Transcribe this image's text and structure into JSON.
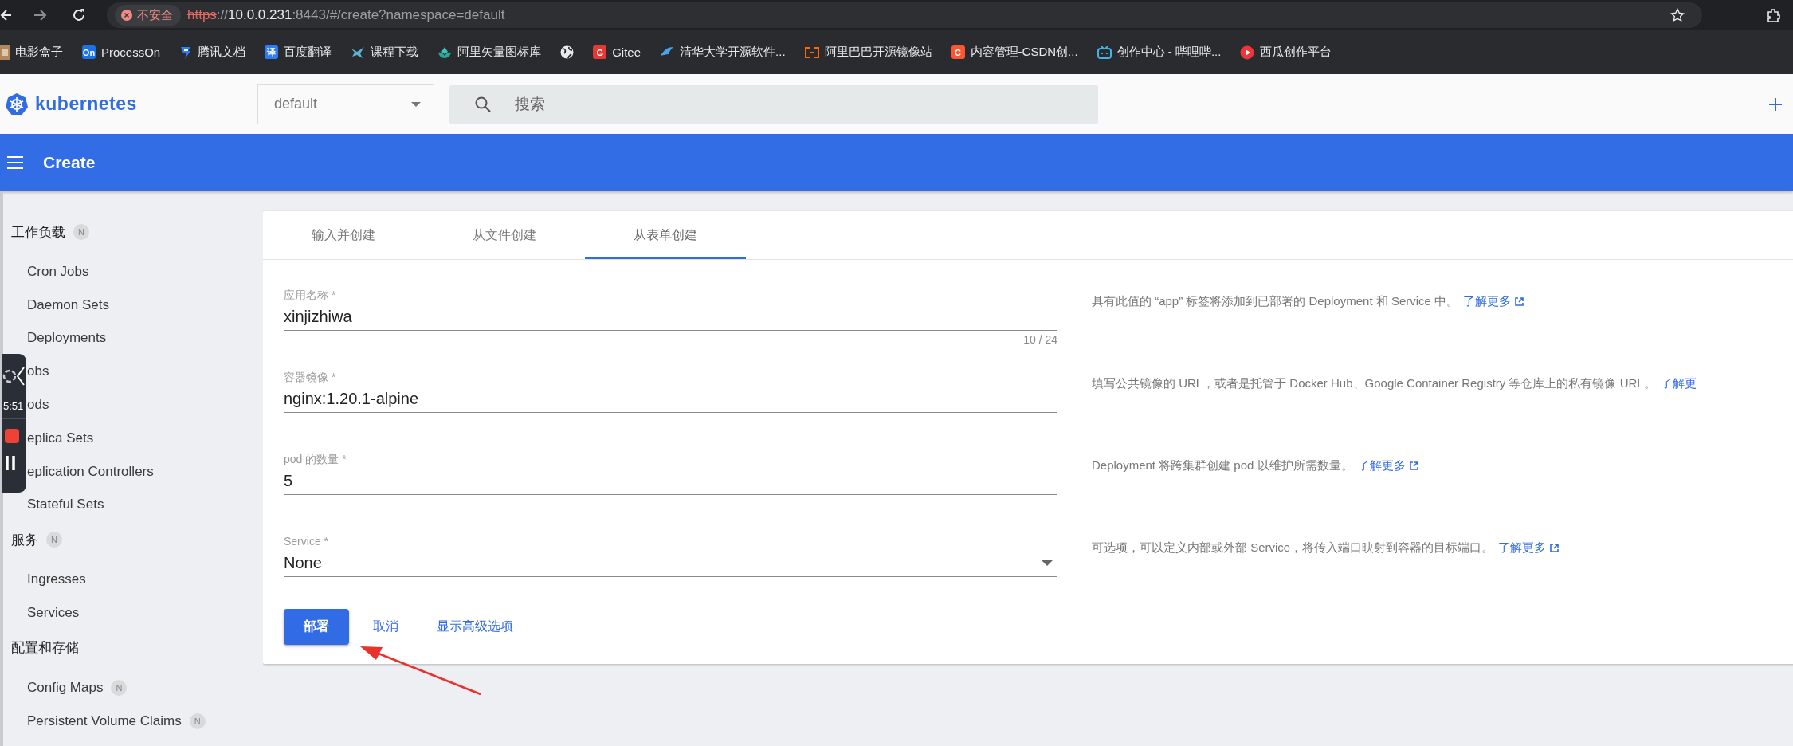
{
  "browser": {
    "security_chip": "不安全",
    "url": [
      {
        "kind": "scheme",
        "text": "https"
      },
      {
        "kind": "separator",
        "text": "://"
      },
      {
        "kind": "host",
        "text": "10.0.0.231"
      },
      {
        "kind": "path",
        "text": ":8443/#/create?namespace=default"
      }
    ],
    "bookmarks": [
      {
        "label": "电影盒子",
        "kind": "image"
      },
      {
        "label": "ProcessOn",
        "kind": "badge",
        "icon_text": "On",
        "color": "#1a73e8"
      },
      {
        "label": "腾讯文档",
        "kind": "doc"
      },
      {
        "label": "百度翻译",
        "kind": "badge",
        "icon_text": "译",
        "color": "#2f7cf6"
      },
      {
        "label": "课程下载",
        "kind": "bird"
      },
      {
        "label": "阿里矢量图标库",
        "kind": "lotus"
      },
      {
        "kind": "globe"
      },
      {
        "label": "Gitee",
        "kind": "badge",
        "icon_text": "G",
        "color": "#e53935"
      },
      {
        "label": "清华大学开源软件...",
        "kind": "wing"
      },
      {
        "label": "阿里巴巴开源镜像站",
        "kind": "bracket"
      },
      {
        "label": "内容管理-CSDN创...",
        "kind": "badge",
        "icon_text": "C",
        "color": "#fc5531"
      },
      {
        "label": "创作中心 - 哔哩哔...",
        "kind": "tv"
      },
      {
        "label": "西瓜创作平台",
        "kind": "play"
      }
    ]
  },
  "header": {
    "brand": "kubernetes",
    "namespace": "default",
    "search_placeholder": "搜索"
  },
  "title_bar": {
    "title": "Create"
  },
  "sidebar": {
    "groups": [
      {
        "title": "工作负载",
        "badge": "N",
        "items": [
          {
            "label": "Cron Jobs"
          },
          {
            "label": "Daemon Sets"
          },
          {
            "label": "Deployments"
          },
          {
            "label": "obs"
          },
          {
            "label": "ods"
          },
          {
            "label": "eplica Sets"
          },
          {
            "label": "eplication Controllers"
          },
          {
            "label": "Stateful Sets"
          }
        ]
      },
      {
        "title": "服务",
        "badge": "N",
        "items": [
          {
            "label": "Ingresses"
          },
          {
            "label": "Services"
          }
        ]
      },
      {
        "title": "配置和存储",
        "items": [
          {
            "label": "Config Maps",
            "badge": "N"
          },
          {
            "label": "Persistent Volume Claims",
            "badge": "N"
          }
        ]
      }
    ]
  },
  "recorder": {
    "time": "5:51"
  },
  "form": {
    "tabs": [
      {
        "label": "输入并创建",
        "selected": false
      },
      {
        "label": "从文件创建",
        "selected": false
      },
      {
        "label": "从表单创建",
        "selected": true
      }
    ],
    "fields": [
      {
        "kind": "text",
        "label": "应用名称 *",
        "value": "xinjizhiwa",
        "counter": "10 / 24",
        "help": "具有此值的 “app” 标签将添加到已部署的 Deployment 和 Service 中。",
        "link": {
          "text": "了解更多",
          "external": true
        }
      },
      {
        "kind": "text",
        "label": "容器镜像 *",
        "value": "nginx:1.20.1-alpine",
        "help": "填写公共镜像的 URL，或者是托管于 Docker Hub、Google Container Registry 等仓库上的私有镜像 URL。",
        "link": {
          "text": "了解更",
          "external": false
        }
      },
      {
        "kind": "text",
        "label": "pod 的数量 *",
        "value": "5",
        "help": "Deployment 将跨集群创建 pod 以维护所需数量。",
        "link": {
          "text": "了解更多",
          "external": true
        }
      },
      {
        "kind": "select",
        "label": "Service *",
        "value": "None",
        "help": "可选项，可以定义内部或外部 Service，将传入端口映射到容器的目标端口。",
        "link": {
          "text": "了解更多",
          "external": true
        }
      }
    ],
    "actions": [
      {
        "kind": "primary",
        "label": "部署"
      },
      {
        "kind": "text",
        "label": "取消"
      },
      {
        "kind": "text",
        "label": "显示高级选项"
      }
    ]
  }
}
